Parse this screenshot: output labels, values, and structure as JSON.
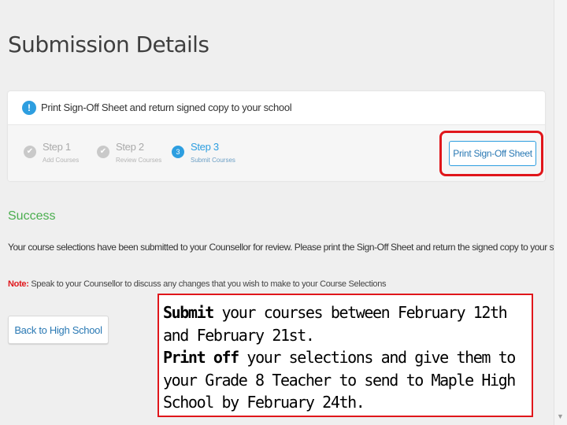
{
  "page": {
    "title": "Submission Details"
  },
  "card": {
    "info_icon": "info-icon",
    "header_text": "Print Sign-Off Sheet and return signed copy to your school",
    "steps": [
      {
        "title": "Step 1",
        "subtitle": "Add Courses",
        "status": "complete",
        "icon": "check-icon"
      },
      {
        "title": "Step 2",
        "subtitle": "Review Courses",
        "status": "complete",
        "icon": "check-icon"
      },
      {
        "title": "Step 3",
        "subtitle": "Submit Courses",
        "status": "active",
        "number": "3"
      }
    ],
    "print_button": "Print Sign-Off Sheet"
  },
  "result": {
    "success": "Success",
    "message": "Your course selections have been submitted to your Counsellor for review. Please print the Sign-Off Sheet and return the signed copy to your school.",
    "note_label": "Note:",
    "note_text": " Speak to your Counsellor to discuss any changes that you wish to make to your Course Selections",
    "back_button": "Back to High School"
  },
  "callout": {
    "line1_bold": "Submit",
    "line1_rest": " your courses between February 12th and February 21st.",
    "line2_bold": "Print off",
    "line2_rest": " your selections and give them to your Grade 8 Teacher to send to Maple High School by February 24th."
  },
  "colors": {
    "accent": "#2d9ee0",
    "success": "#4bae4f",
    "highlight": "#e0161b"
  }
}
